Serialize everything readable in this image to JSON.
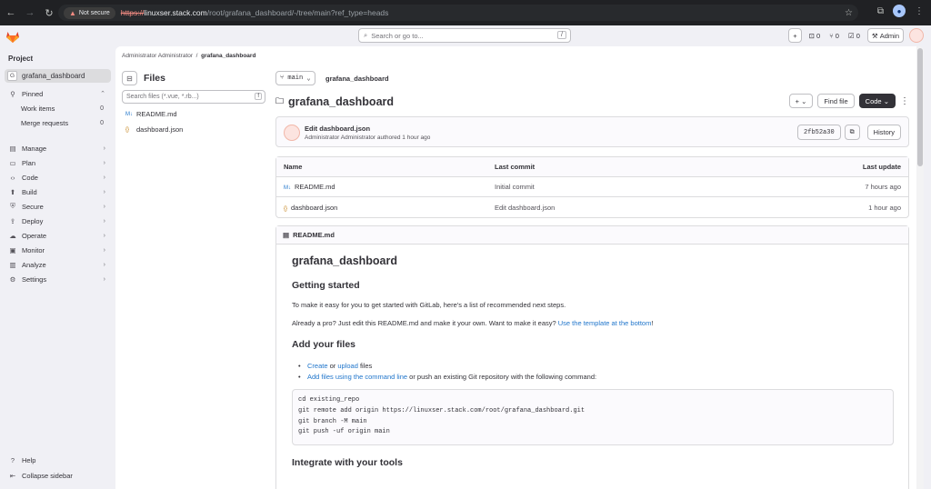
{
  "browser": {
    "not_secure": "Not secure",
    "url_scheme": "https://",
    "url_host": "linuxser.stack.com",
    "url_path": "/root/grafana_dashboard/-/tree/main?ref_type=heads"
  },
  "topbar": {
    "search_placeholder": "Search or go to...",
    "search_kbd": "/",
    "plus": "+",
    "issues_count": "0",
    "mr_count": "0",
    "todo_count": "0",
    "admin_label": "Admin"
  },
  "sidebar": {
    "section": "Project",
    "project_initial": "G",
    "project_name": "grafana_dashboard",
    "pinned": "Pinned",
    "work_items": "Work items",
    "work_items_count": "0",
    "merge_requests": "Merge requests",
    "merge_requests_count": "0",
    "menu": [
      "Manage",
      "Plan",
      "Code",
      "Build",
      "Secure",
      "Deploy",
      "Operate",
      "Monitor",
      "Analyze",
      "Settings"
    ],
    "help": "Help",
    "collapse": "Collapse sidebar"
  },
  "breadcrumb": {
    "parent": "Administrator Administrator",
    "sep": "/",
    "current": "grafana_dashboard"
  },
  "files_panel": {
    "title": "Files",
    "search_placeholder": "Search files (*.vue, *.rb...)",
    "search_kbd": "f",
    "items": [
      "README.md",
      "dashboard.json"
    ]
  },
  "repo": {
    "branch": "main",
    "path": "grafana_dashboard",
    "title": "grafana_dashboard",
    "add_label": "+",
    "find_file": "Find file",
    "code_label": "Code"
  },
  "commit": {
    "title": "Edit dashboard.json",
    "author": "Administrator Administrator",
    "authored": "authored 1 hour ago",
    "sha": "2fb52a30",
    "history": "History"
  },
  "file_table": {
    "headers": [
      "Name",
      "Last commit",
      "Last update"
    ],
    "rows": [
      {
        "name": "README.md",
        "commit": "Initial commit",
        "updated": "7 hours ago"
      },
      {
        "name": "dashboard.json",
        "commit": "Edit dashboard.json",
        "updated": "1 hour ago"
      }
    ]
  },
  "readme": {
    "file": "README.md",
    "h1": "grafana_dashboard",
    "getting_started": "Getting started",
    "p1": "To make it easy for you to get started with GitLab, here's a list of recommended next steps.",
    "p2_text": "Already a pro? Just edit this README.md and make it your own. Want to make it easy? ",
    "p2_link": "Use the template at the bottom",
    "p2_end": "!",
    "add_files": "Add your files",
    "li1_create": "Create",
    "li1_or": " or ",
    "li1_upload": "upload",
    "li1_end": " files",
    "li2_link": "Add files using the command line",
    "li2_end": " or push an existing Git repository with the following command:",
    "code": [
      "cd existing_repo",
      "git remote add origin https://linuxser.stack.com/root/grafana_dashboard.git",
      "git branch -M main",
      "git push -uf origin main"
    ],
    "integrate": "Integrate with your tools"
  }
}
